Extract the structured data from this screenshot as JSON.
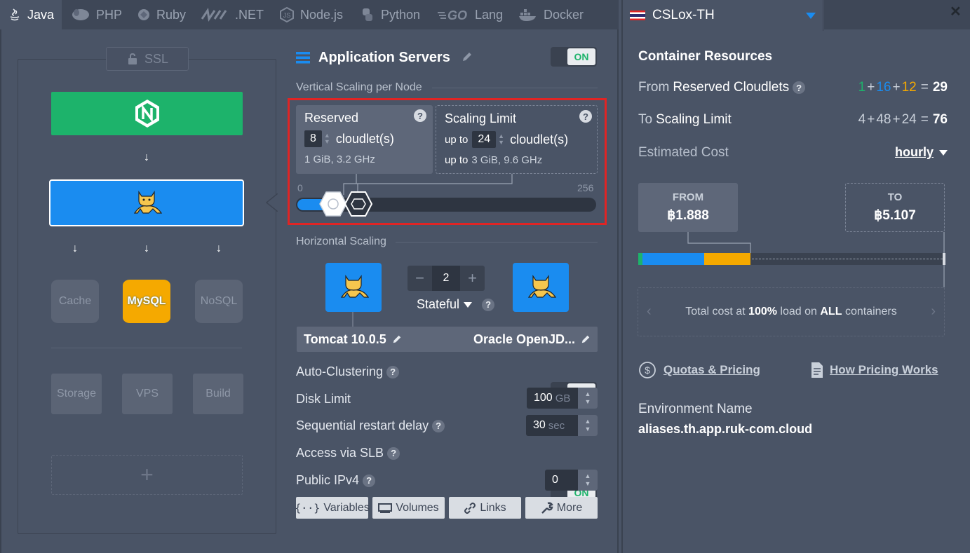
{
  "tabs": [
    {
      "label": "Java",
      "icon": "java-icon"
    },
    {
      "label": "PHP",
      "icon": "php-icon"
    },
    {
      "label": "Ruby",
      "icon": "ruby-icon"
    },
    {
      "label": ".NET",
      "icon": "dotnet-icon"
    },
    {
      "label": "Node.js",
      "icon": "nodejs-icon"
    },
    {
      "label": "Python",
      "icon": "python-icon"
    },
    {
      "label": "Lang",
      "icon": "go-icon"
    },
    {
      "label": "Docker",
      "icon": "docker-icon"
    }
  ],
  "topology": {
    "ssl_label": "SSL",
    "cache_label": "Cache",
    "mysql_label": "MySQL",
    "nosql_label": "NoSQL",
    "storage_label": "Storage",
    "vps_label": "VPS",
    "build_label": "Build",
    "add_label": "+"
  },
  "app_servers": {
    "title": "Application Servers",
    "toggle": "ON"
  },
  "vertical": {
    "title": "Vertical Scaling per Node",
    "reserved_title": "Reserved",
    "reserved_value": "8",
    "reserved_unit": "cloudlet(s)",
    "reserved_spec": "1 GiB, 3.2 GHz",
    "limit_title": "Scaling Limit",
    "limit_prefix": "up to",
    "limit_value": "24",
    "limit_unit": "cloudlet(s)",
    "limit_spec_prefix": "up to",
    "limit_spec": "3 GiB, 9.6 GHz",
    "slider_min": "0",
    "slider_max": "256",
    "help": "?"
  },
  "horizontal": {
    "title": "Horizontal Scaling",
    "count": "2",
    "minus": "−",
    "plus": "+",
    "mode": "Stateful",
    "help": "?"
  },
  "stack": {
    "server": "Tomcat 10.0.5",
    "jdk": "Oracle OpenJD..."
  },
  "settings": {
    "auto_clustering": "Auto-Clustering",
    "auto_clustering_toggle": "ON",
    "disk_limit": "Disk Limit",
    "disk_value": "100",
    "disk_unit": "GB",
    "restart_delay": "Sequential restart delay",
    "restart_value": "30",
    "restart_unit": "sec",
    "slb": "Access via SLB",
    "slb_toggle": "ON",
    "ipv4": "Public IPv4",
    "ipv4_value": "0",
    "help": "?"
  },
  "tools": {
    "variables": "Variables",
    "volumes": "Volumes",
    "links": "Links",
    "more": "More"
  },
  "right": {
    "region": "CSLox-TH",
    "close": "✕",
    "resources_title": "Container Resources",
    "from_label": "From",
    "from_label_strong": "Reserved Cloudlets",
    "from_sum": {
      "a": "1",
      "b": "16",
      "c": "12",
      "total": "29",
      "plus": "+",
      "eq": "="
    },
    "to_label": "To",
    "to_label_strong": "Scaling Limit",
    "to_sum": {
      "a": "4",
      "b": "48",
      "c": "24",
      "total": "76",
      "plus": "+",
      "eq": "="
    },
    "estimated_cost": "Estimated Cost",
    "period": "hourly",
    "from_caption": "FROM",
    "from_price": "฿1.888",
    "to_caption": "TO",
    "to_price": "฿5.107",
    "total_pre": "Total cost at",
    "total_pct": "100%",
    "total_mid": "load on",
    "total_all": "ALL",
    "total_post": "containers",
    "quotas_link": "Quotas & Pricing",
    "how_link": "How Pricing Works",
    "env_name_label": "Environment Name",
    "env_name_value": "aliases.th.app.ruk-com.cloud"
  },
  "colors": {
    "accent_blue": "#1a8cf0",
    "green": "#1db36b",
    "orange": "#f5a900",
    "highlight_red": "#e02424"
  }
}
